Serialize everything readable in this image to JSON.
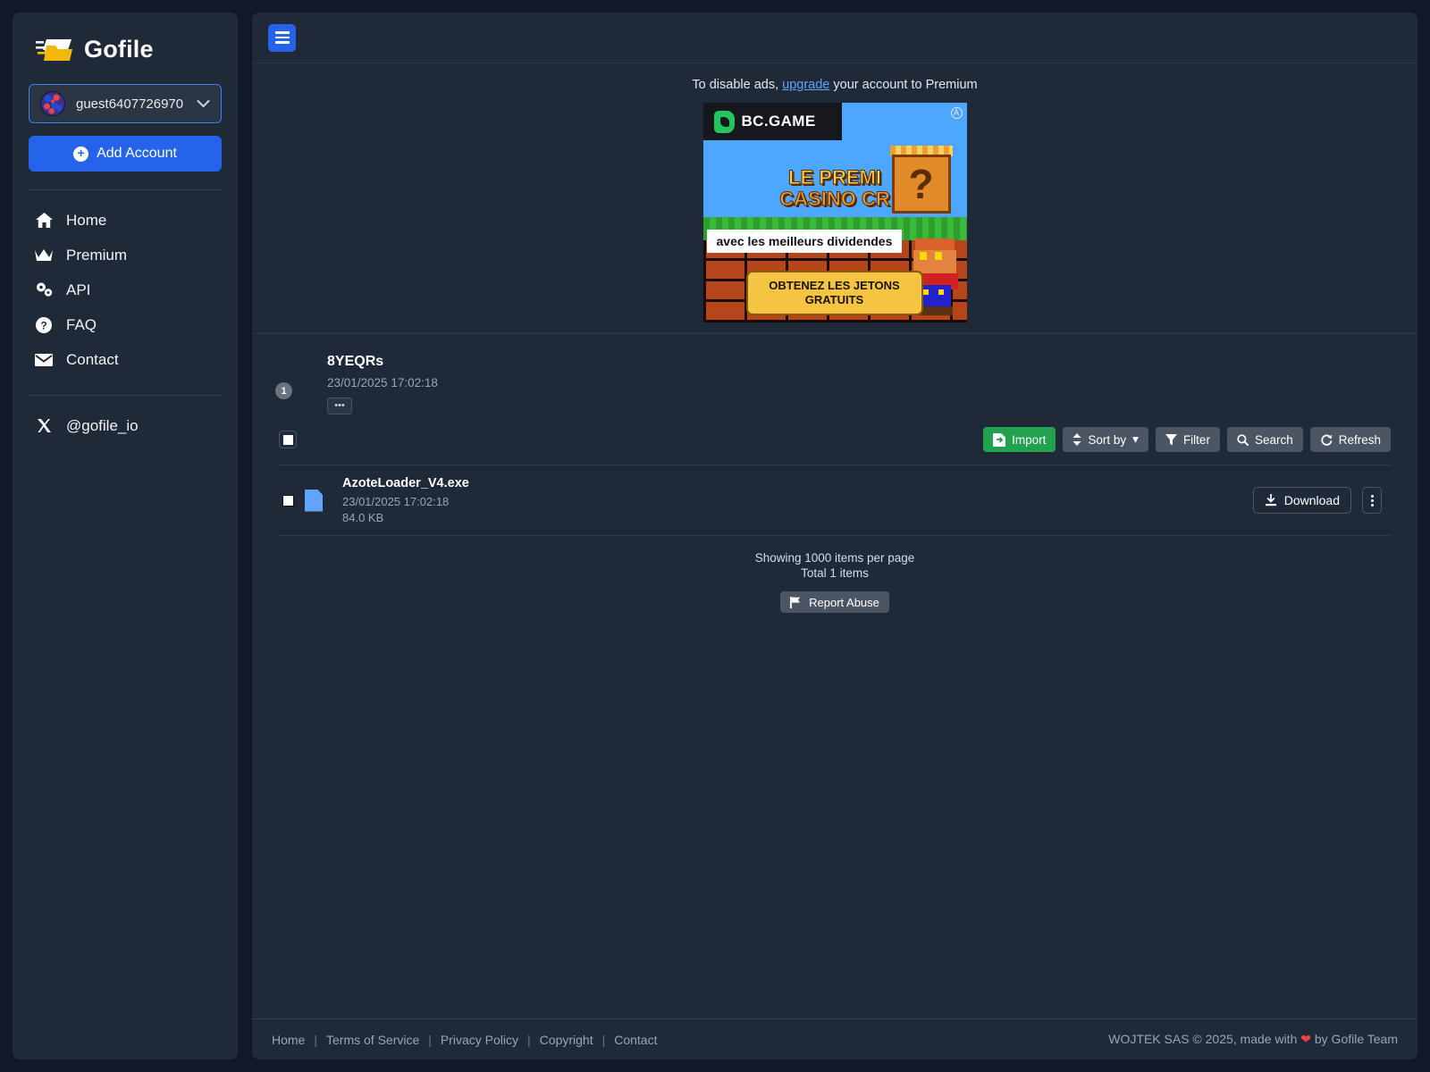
{
  "brand": {
    "name": "Gofile",
    "logo_icon": "gofile-folder-logo"
  },
  "sidebar": {
    "account": {
      "name": "guest6407726970",
      "avatar_icon": "identicon-avatar",
      "chevron_icon": "chevron-down-icon"
    },
    "add_account_label": "Add Account",
    "items": [
      {
        "label": "Home",
        "icon": "home-icon"
      },
      {
        "label": "Premium",
        "icon": "crown-icon"
      },
      {
        "label": "API",
        "icon": "gears-icon"
      },
      {
        "label": "FAQ",
        "icon": "question-circle-icon"
      },
      {
        "label": "Contact",
        "icon": "envelope-icon"
      }
    ],
    "social": {
      "label": "@gofile_io",
      "icon": "x-twitter-icon"
    }
  },
  "topbar": {
    "menu_icon": "hamburger-menu-icon"
  },
  "ad": {
    "notice_prefix": "To disable ads,",
    "notice_link": "upgrade",
    "notice_suffix": "your account to Premium",
    "brand": "BC.GAME",
    "headline_line1": "LE PREMI",
    "headline_line2": "CASINO CR",
    "subtitle": "avec les meilleurs dividendes",
    "cta": "OBTENEZ LES JETONS GRATUITS",
    "badge": "A"
  },
  "folder": {
    "name": "8YEQRs",
    "date": "23/01/2025 17:02:18",
    "child_count": "1",
    "more_label": "•••",
    "icon": "folder-open-icon"
  },
  "toolbar": {
    "select_all_icon": "checkbox-checked-icon",
    "buttons": [
      {
        "label": "Import",
        "icon": "import-icon",
        "style": "green"
      },
      {
        "label": "Sort by",
        "icon": "sort-icon",
        "caret": "▾",
        "style": "grey"
      },
      {
        "label": "Filter",
        "icon": "funnel-icon",
        "style": "grey"
      },
      {
        "label": "Search",
        "icon": "search-icon",
        "style": "grey"
      },
      {
        "label": "Refresh",
        "icon": "refresh-icon",
        "style": "grey"
      }
    ]
  },
  "files": [
    {
      "name": "AzoteLoader_V4.exe",
      "date": "23/01/2025 17:02:18",
      "size": "84.0 KB",
      "icon": "file-icon",
      "download_label": "Download",
      "download_icon": "download-icon",
      "menu_icon": "kebab-menu-icon"
    }
  ],
  "pager": {
    "per_page": "Showing 1000 items per page",
    "total": "Total 1 items",
    "abuse_label": "Report Abuse",
    "abuse_icon": "flag-icon"
  },
  "footer": {
    "links": [
      "Home",
      "Terms of Service",
      "Privacy Policy",
      "Copyright",
      "Contact"
    ],
    "copyright_prefix": "WOJTEK SAS © 2025, made with",
    "copyright_suffix": "by Gofile Team",
    "heart_icon": "heart-icon"
  },
  "colors": {
    "page_bg": "#111827",
    "panel_bg": "#1f2937",
    "accent_blue": "#2563eb",
    "accent_green": "#22a14e",
    "link_blue": "#60a5fa",
    "muted_text": "#9aa5b4",
    "heart_red": "#ef4444",
    "folder_yellow": "#f5c518",
    "file_blue": "#60a5fa"
  }
}
